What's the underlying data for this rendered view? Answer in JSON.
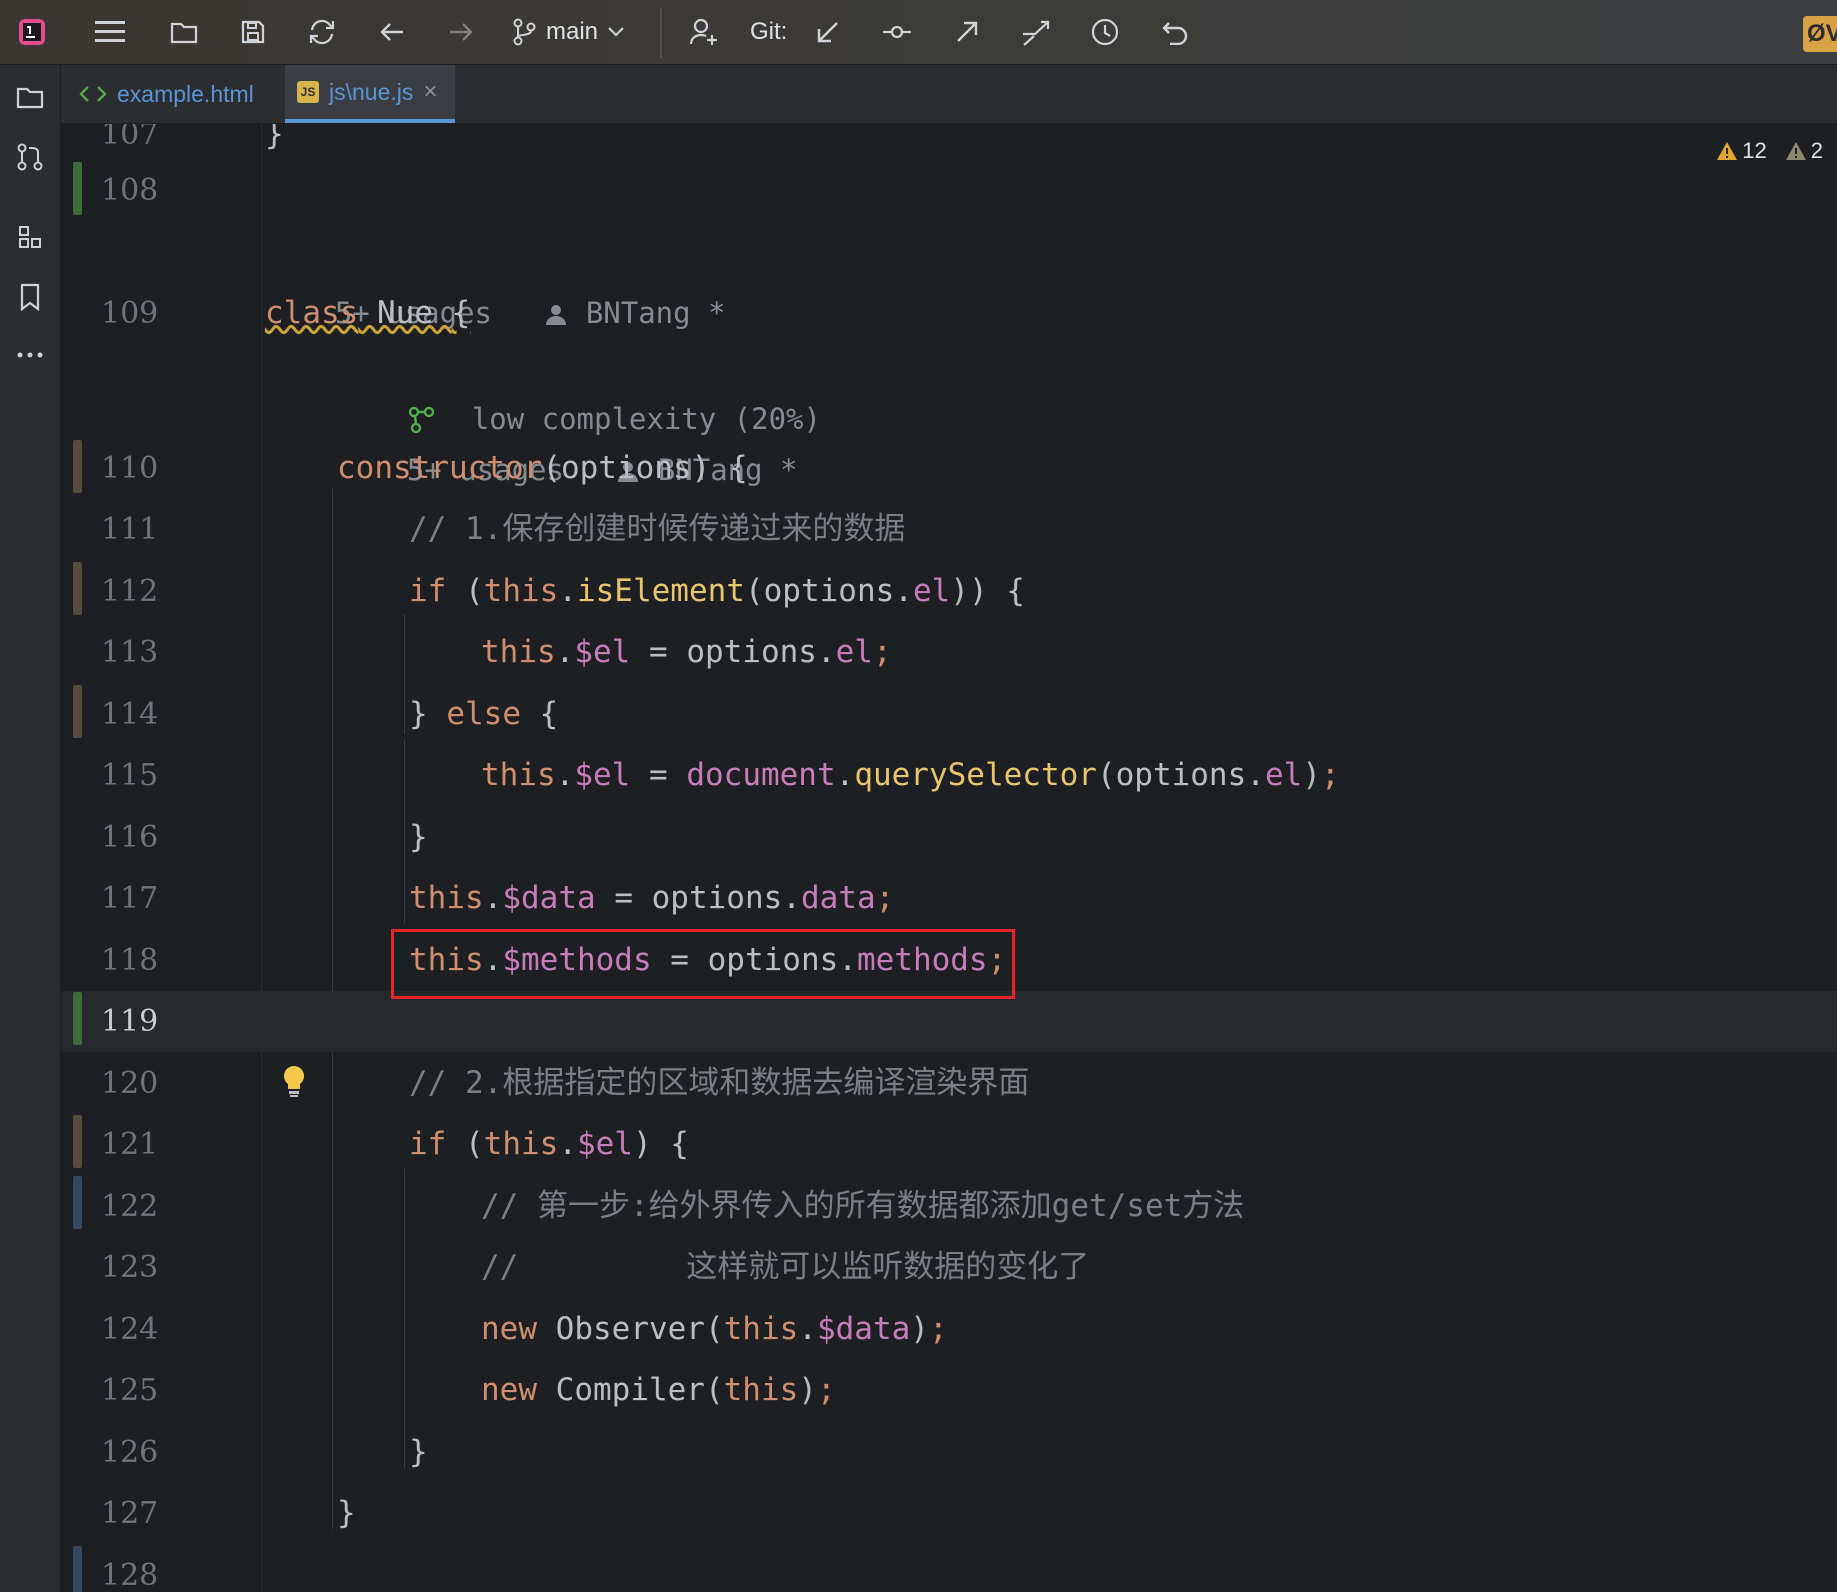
{
  "toolbar": {
    "branch": "main",
    "git_label": "Git:",
    "badge": "ØV"
  },
  "tabs": [
    {
      "label": "example.html",
      "icon": "html-icon"
    },
    {
      "label": "js\\nue.js",
      "icon": "js-file-icon",
      "badge": "JS"
    }
  ],
  "inspections": {
    "warnings": "12",
    "weak_warnings": "2"
  },
  "lines": [
    {
      "n": "107"
    },
    {
      "n": "108"
    },
    {
      "n": "109"
    },
    {
      "n": "110"
    },
    {
      "n": "111"
    },
    {
      "n": "112"
    },
    {
      "n": "113"
    },
    {
      "n": "114"
    },
    {
      "n": "115"
    },
    {
      "n": "116"
    },
    {
      "n": "117"
    },
    {
      "n": "118"
    },
    {
      "n": "119"
    },
    {
      "n": "120"
    },
    {
      "n": "121"
    },
    {
      "n": "122"
    },
    {
      "n": "123"
    },
    {
      "n": "124"
    },
    {
      "n": "125"
    },
    {
      "n": "126"
    },
    {
      "n": "127"
    },
    {
      "n": "128"
    }
  ],
  "hints": {
    "class_usages": "5+ usages",
    "class_author": "BNTang *",
    "complexity": "low complexity (20%)",
    "ctor_usages": "5+ usages",
    "ctor_author": "BNTang *"
  },
  "code": {
    "l107": "}",
    "l109_kw": "class",
    "l109_name": " Nue ",
    "l109_brace": "{",
    "l110_fn": "constructor",
    "l110_rest": "(options) {",
    "l111": "// 1.保存创建时候传递过来的数据",
    "l112_if": "if",
    "l112_a": " (",
    "l112_this": "this",
    "l112_dot": ".",
    "l112_fn": "isElement",
    "l112_b": "(options.",
    "l112_el": "el",
    "l112_c": ")) {",
    "l113_this": "this",
    "l113_dot": ".",
    "l113_fld": "$el",
    "l113_mid": " = options.",
    "l113_el": "el",
    "l113_semi": ";",
    "l114_a": "} ",
    "l114_else": "else",
    "l114_b": " {",
    "l115_this": "this",
    "l115_dot": ".",
    "l115_fld": "$el",
    "l115_mid": " = ",
    "l115_doc": "document",
    "l115_dot2": ".",
    "l115_fn": "querySelector",
    "l115_b": "(options.",
    "l115_el": "el",
    "l115_c": ")",
    "l115_semi": ";",
    "l116": "}",
    "l117_this": "this",
    "l117_dot": ".",
    "l117_fld": "$data",
    "l117_mid": " = options.",
    "l117_data": "data",
    "l117_semi": ";",
    "l118_this": "this",
    "l118_dot": ".",
    "l118_fld": "$methods",
    "l118_mid": " = options.",
    "l118_m": "methods",
    "l118_semi": ";",
    "l120": "// 2.根据指定的区域和数据去编译渲染界面",
    "l121_if": "if",
    "l121_a": " (",
    "l121_this": "this",
    "l121_dot": ".",
    "l121_fld": "$el",
    "l121_b": ") {",
    "l122": "// 第一步:给外界传入的所有数据都添加get/set方法",
    "l123": "//         这样就可以监听数据的变化了",
    "l124_new": "new",
    "l124_cls": " Observer(",
    "l124_this": "this",
    "l124_dot": ".",
    "l124_fld": "$data",
    "l124_c": ")",
    "l124_semi": ";",
    "l125_new": "new",
    "l125_cls": " Compiler(",
    "l125_this": "this",
    "l125_c": ")",
    "l125_semi": ";",
    "l126": "}",
    "l127": "}"
  },
  "colors": {
    "keyword": "#cf8e6d",
    "function": "#e8c46a",
    "field": "#c77dbb",
    "comment": "#7a7e85",
    "highlight_box": "#e5242c"
  }
}
